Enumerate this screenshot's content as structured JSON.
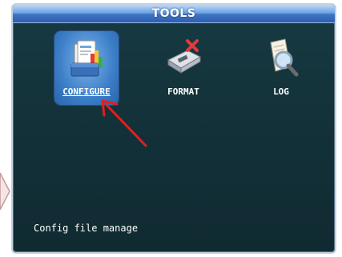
{
  "window": {
    "title": "TOOLS"
  },
  "tools": [
    {
      "label": "CONFIGURE",
      "icon": "configure-icon",
      "selected": true
    },
    {
      "label": "FORMAT",
      "icon": "format-disk-icon",
      "selected": false
    },
    {
      "label": "LOG",
      "icon": "log-search-icon",
      "selected": false
    }
  ],
  "status": {
    "text": "Config file manage"
  },
  "colors": {
    "panel_bg": "#133139",
    "title_bar": "#3f74c4",
    "selection": "#3c7fc8",
    "annotation_arrow": "#e0201e"
  }
}
